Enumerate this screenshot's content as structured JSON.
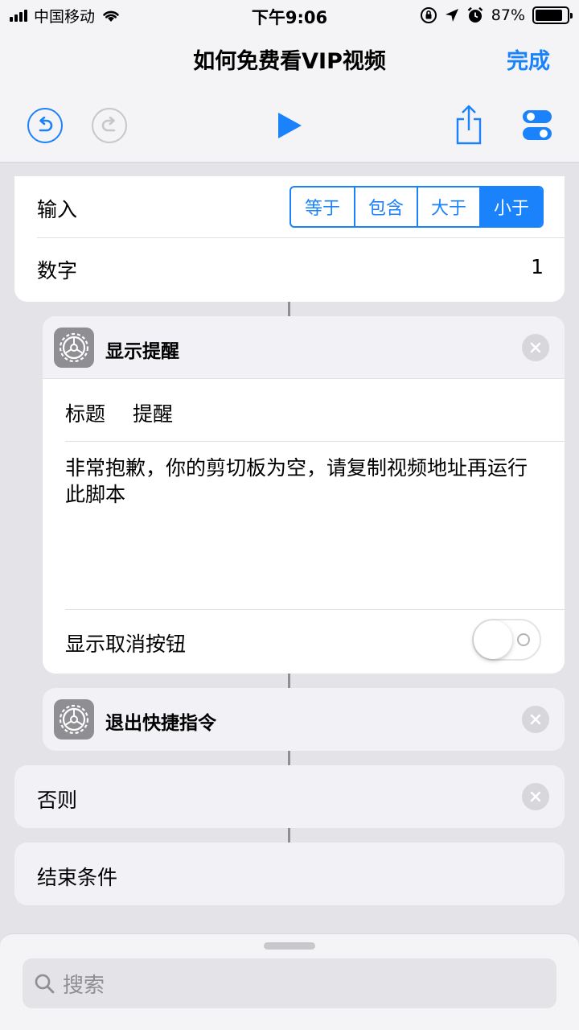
{
  "status_bar": {
    "carrier": "中国移动",
    "time": "下午9:06",
    "battery": "87%",
    "battery_level": 0.87
  },
  "nav": {
    "title": "如何免费看VIP视频",
    "done_label": "完成"
  },
  "toolbar": {
    "icons": [
      "undo-icon",
      "redo-icon",
      "play-icon",
      "share-icon",
      "settings-toggle-icon"
    ]
  },
  "condition_card": {
    "input_label": "输入",
    "options": [
      "等于",
      "包含",
      "大于",
      "小于"
    ],
    "selected": "小于",
    "number_label": "数字",
    "number_value": "1"
  },
  "alert_action": {
    "name": "显示提醒",
    "title_label": "标题",
    "title_value": "提醒",
    "message": "非常抱歉，你的剪切板为空，请复制视频地址再运行此脚本",
    "cancel_label": "显示取消按钮",
    "cancel_enabled": false
  },
  "exit_action": {
    "name": "退出快捷指令"
  },
  "otherwise": {
    "label": "否则"
  },
  "end_if": {
    "label": "结束条件"
  },
  "search": {
    "placeholder": "搜索"
  },
  "colors": {
    "accent": "#1a82fb",
    "background": "#e3e3e8",
    "icon_gray": "#8e8e93"
  }
}
